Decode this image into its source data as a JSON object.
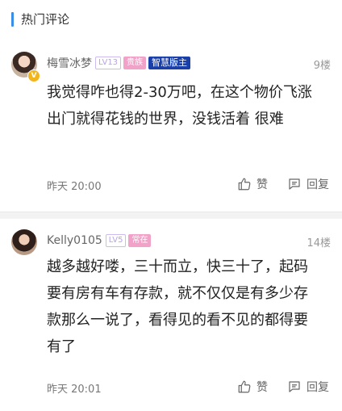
{
  "section": {
    "title": "热门评论",
    "accent_color": "#3a8ee6"
  },
  "comments": [
    {
      "username": "梅雪冰梦",
      "level": "LV13",
      "tags": [
        "贵族",
        "智慧版主"
      ],
      "vip_badge": "V",
      "floor": "9楼",
      "content": "我觉得咋也得2-30万吧，在这个物价飞涨  出门就得花钱的世界，没钱活着  很难",
      "time": "昨天 20:00",
      "like_label": "赞",
      "reply_label": "回复"
    },
    {
      "username": "Kelly0105",
      "level": "LV5",
      "tags": [
        "常在"
      ],
      "floor": "14楼",
      "content": "越多越好喽，三十而立，快三十了，起码要有房有车有存款，就不仅仅是有多少存款那么一说了，看得见的看不见的都得要有了",
      "time": "昨天 20:01",
      "like_label": "赞",
      "reply_label": "回复"
    }
  ],
  "icons": {
    "like": "thumbs-up-icon",
    "reply": "comment-icon"
  }
}
